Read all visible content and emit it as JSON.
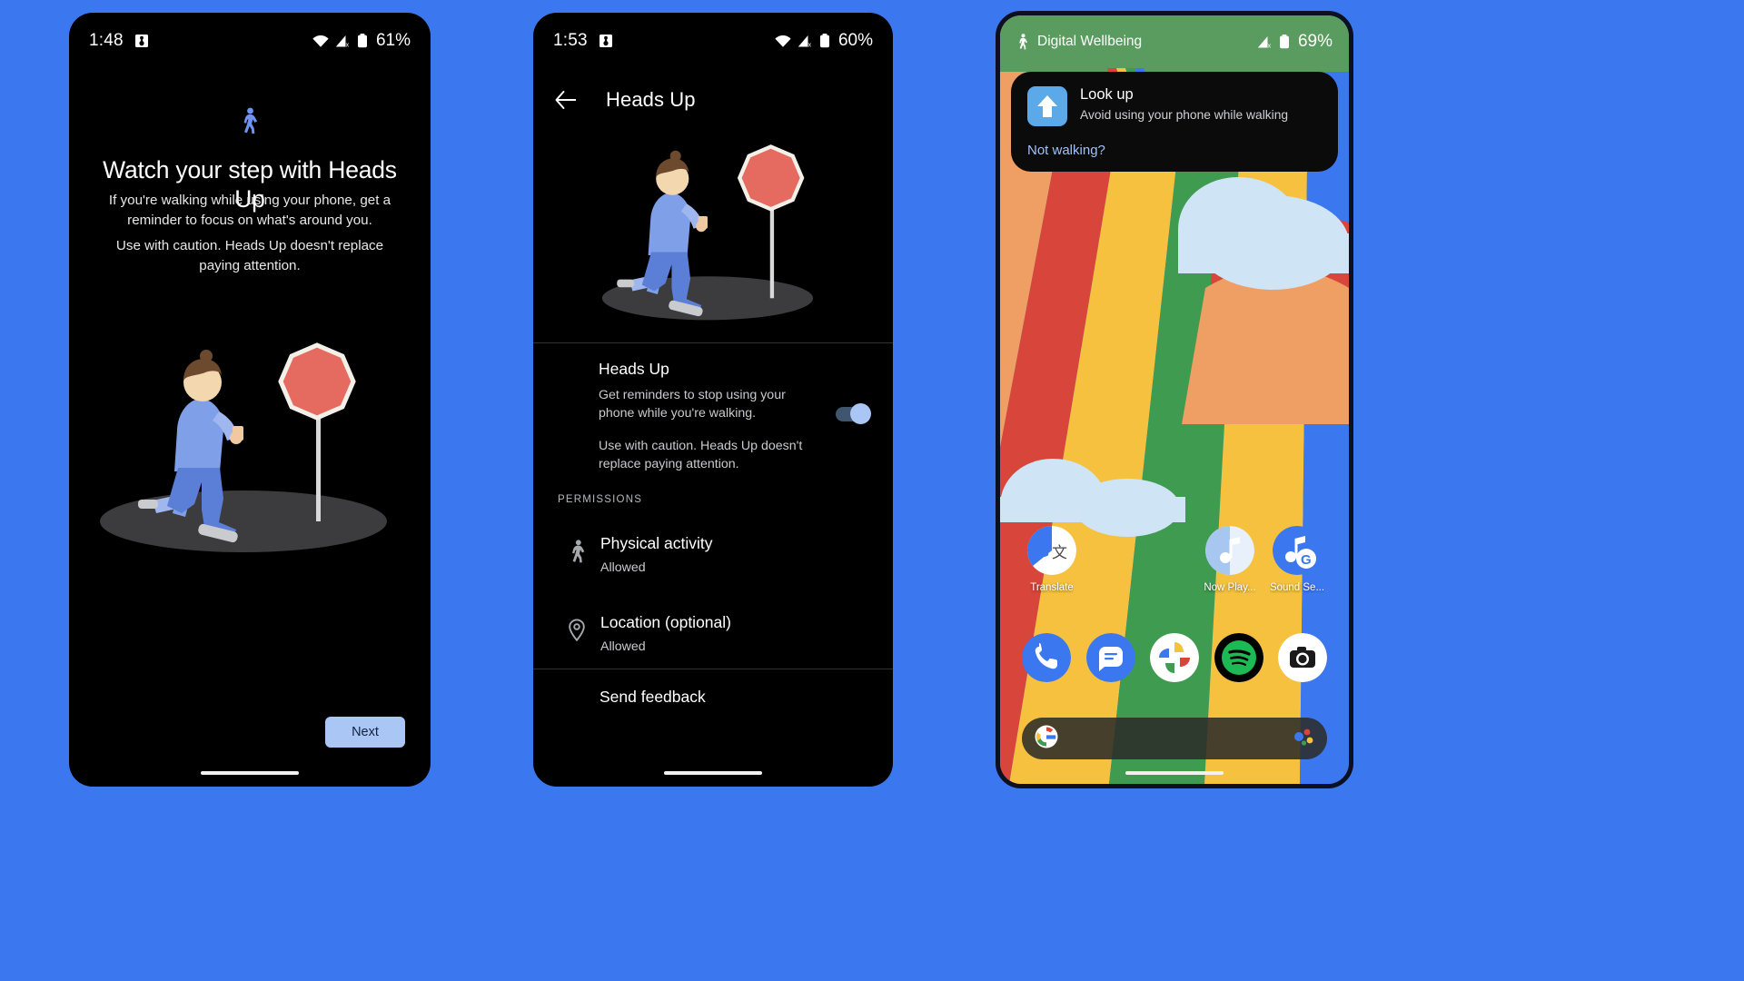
{
  "background_color": "#3b78f0",
  "phone1": {
    "name": "heads-up-onboarding",
    "statusbar": {
      "time": "1:48",
      "battery_percent": "61%",
      "icons": [
        "notification-app-icon",
        "wifi-icon",
        "cellular-icon",
        "battery-icon"
      ]
    },
    "top_icon": "walking-person-icon",
    "title": "Watch your step with Heads Up",
    "body1": "If you're walking while using your phone, get a reminder to focus on what's around you.",
    "body2": "Use with caution. Heads Up doesn't replace paying attention.",
    "next_button": "Next",
    "illustration": "person-walking-past-stop-sign"
  },
  "phone2": {
    "name": "heads-up-settings",
    "statusbar": {
      "time": "1:53",
      "battery_percent": "60%",
      "icons": [
        "notification-app-icon",
        "wifi-icon",
        "cellular-icon",
        "battery-icon"
      ]
    },
    "appbar": {
      "back": "back-arrow-icon",
      "title": "Heads Up"
    },
    "illustration": "person-walking-past-stop-sign",
    "setting": {
      "title": "Heads Up",
      "sub1": "Get reminders to stop using your phone while you're walking.",
      "sub2": "Use with caution. Heads Up doesn't replace paying attention.",
      "toggle_on": true
    },
    "permissions_label": "PERMISSIONS",
    "permissions": [
      {
        "icon": "running-person-icon",
        "title": "Physical activity",
        "status": "Allowed"
      },
      {
        "icon": "location-pin-icon",
        "title": "Location (optional)",
        "status": "Allowed"
      }
    ],
    "send_feedback": "Send feedback"
  },
  "phone3": {
    "name": "home-screen-with-heads-up-notification",
    "statusbar": {
      "app_icon": "walking-person-icon",
      "app_label": "Digital Wellbeing",
      "battery_percent": "69%",
      "icons": [
        "cellular-icon",
        "battery-icon"
      ]
    },
    "notification": {
      "icon": "look-up-arrow-icon",
      "title": "Look up",
      "subtitle": "Avoid using your phone while walking",
      "action": "Not walking?"
    },
    "apps_top": [
      {
        "icon": "google-translate-icon",
        "label": "Translate"
      },
      {
        "icon": "now-playing-icon",
        "label": "Now Play..."
      },
      {
        "icon": "sound-search-icon",
        "label": "Sound Se..."
      }
    ],
    "dock": [
      {
        "icon": "phone-icon"
      },
      {
        "icon": "messages-icon"
      },
      {
        "icon": "google-photos-icon"
      },
      {
        "icon": "spotify-icon"
      },
      {
        "icon": "camera-icon"
      }
    ],
    "search": {
      "left_icon": "google-g-icon",
      "right_icon": "google-assistant-icon"
    },
    "wallpaper": "pixel-rainbow-stripes-with-clouds"
  },
  "colors": {
    "accent_blue": "#3b78f0",
    "button_blue": "#aac6f5",
    "surface_dark": "#000000",
    "stop_sign_red": "#e56a60",
    "figure_blue": "#5b7fd6"
  }
}
